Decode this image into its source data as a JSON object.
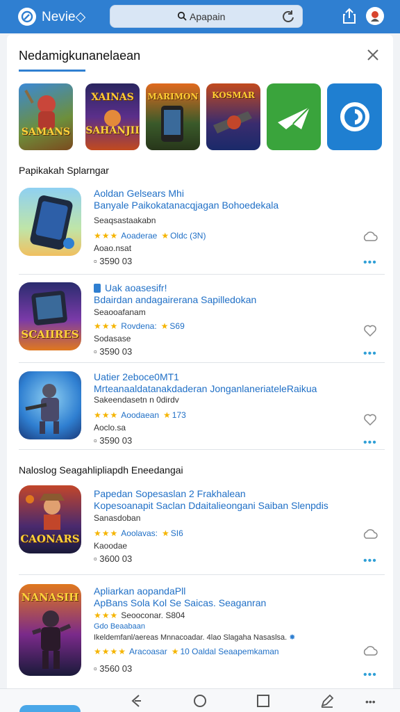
{
  "topbar": {
    "brand": "Nevie◇",
    "search_text": "Apapain",
    "logo_icon": "brand-logo-icon",
    "icons": [
      "search-icon",
      "refresh-icon",
      "share-icon",
      "avatar-icon"
    ]
  },
  "panel": {
    "title": "Nedamigkunanelaean",
    "close_icon": "close-icon",
    "thumbnails": [
      {
        "caption": "SAMANS",
        "bg": "#6b8a3a"
      },
      {
        "caption": "SAHANJII",
        "top_caption": "XAINAS",
        "bg": "#3a2c6e"
      },
      {
        "caption": "",
        "top_caption": "MARIMON",
        "bg": "#4b5a2c"
      },
      {
        "caption": "",
        "top_caption": "KOSMAR",
        "bg": "#243a7a"
      },
      {
        "caption": "",
        "bg": "#3aa43c"
      },
      {
        "caption": "",
        "bg": "#1f7fd1"
      }
    ]
  },
  "sections": [
    {
      "label": "Papikakah Splarngar"
    },
    {
      "label": "Naloslog Seagahlipliapdh Eneedangai"
    }
  ],
  "apps": [
    {
      "name": "Aoldan Gelsears Mhi",
      "subtitle": "Banyale Paikokatanacqjagan Bohoedekala",
      "developer": "Seaqsastaakabn",
      "rating_label": "Aoaderae",
      "rating_extra": "Oldc (3N)",
      "meta": "Aoao.nsat",
      "size": "3590  03",
      "icon_caption": ""
    },
    {
      "name": "Uak aoasesifr!",
      "subtitle": "Bdairdan andagairerana Sapilledokan",
      "developer": "Seaooafanam",
      "rating_label": "Rovdena:",
      "rating_extra": "S69",
      "meta": "Sodasase",
      "size": "3590  03",
      "icon_caption": "SCAIIRES"
    },
    {
      "name": "Uatier 2eboce0MT1",
      "subtitle": "Mrteanaaldatanakdaderan JonganlaneriateleRaikua",
      "developer": "Sakeendasetn n 0dirdv",
      "rating_label": "Aoodaean",
      "rating_extra": "173",
      "meta": "Aoclo.sa",
      "size": "3590  03",
      "icon_caption": ""
    },
    {
      "name": "Papedan Sopesaslan 2 Frakhalean",
      "subtitle": "Kopesoanapit Saclan Ddaitalieongani Saiban Slenpdis",
      "developer": "Sanasdoban",
      "rating_label": "Aoolavas:",
      "rating_extra": "SI6",
      "meta": "Kaoodae",
      "size": "3600  03",
      "icon_caption": "CAONARS"
    },
    {
      "name": "Apliarkan aopandaPll",
      "subtitle": "ApBans Sola Kol Se Saicas. Seaganran",
      "developer": "Seooconar. S804",
      "extra_label": "Gdo Beaabaan",
      "extra_line": "Ikeldemfanl/aereas Mnnacoadar. 4lao Slagaha Nasaslsa.",
      "rating_label": "Aracoasar",
      "rating_extra": "10 Oaldal  Seaapemkaman",
      "size": "3560  03",
      "icon_caption": "NANASIH"
    }
  ],
  "bottom_nav": {
    "icons": [
      "back-icon",
      "home-icon",
      "recents-icon",
      "edit-icon",
      "more-icon"
    ]
  },
  "colors": {
    "accent": "#2f7fd1",
    "link": "#1f6fc6",
    "star": "#f5b400"
  }
}
